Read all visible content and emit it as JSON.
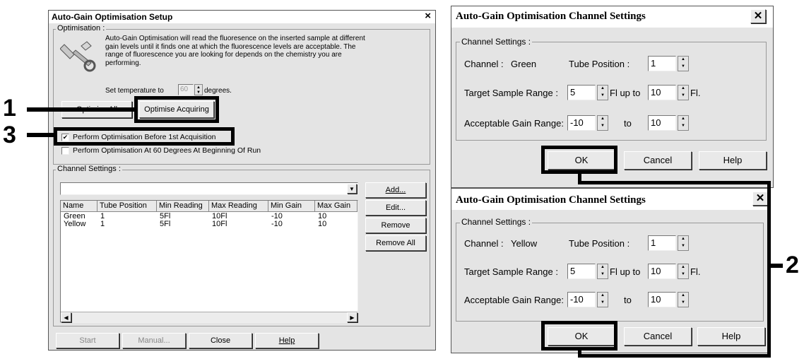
{
  "left_dialog": {
    "title": "Auto-Gain Optimisation Setup",
    "close_glyph": "×",
    "optimisation": {
      "group_label": "Optimisation :",
      "description": "Auto-Gain Optimisation will read the fluoresence on the inserted sample at different gain levels until it finds one at which the fluorescence levels are acceptable. The range of fluorescence you are looking for depends on the chemistry you are performing.",
      "temp_prefix": "Set temperature to",
      "temp_value": "60",
      "temp_suffix": "degrees.",
      "optimise_all": "Optimise All",
      "optimise_acquiring": "Optimise Acquiring",
      "check1_label": "Perform Optimisation Before 1st Acquisition",
      "check1_checked": true,
      "check1_mark": "✔",
      "check2_label": "Perform Optimisation At 60 Degrees At Beginning Of Run",
      "check2_checked": false
    },
    "channel_settings": {
      "group_label": "Channel Settings :",
      "columns": [
        "Name",
        "Tube Position",
        "Min Reading",
        "Max Reading",
        "Min Gain",
        "Max Gain"
      ],
      "rows": [
        [
          "Green",
          "1",
          "5Fl",
          "10Fl",
          "-10",
          "10"
        ],
        [
          "Yellow",
          "1",
          "5Fl",
          "10Fl",
          "-10",
          "10"
        ]
      ],
      "add": "Add...",
      "edit": "Edit...",
      "remove": "Remove",
      "remove_all": "Remove All"
    },
    "footer": {
      "start": "Start",
      "manual": "Manual...",
      "close": "Close",
      "help": "Help"
    }
  },
  "right_dialogs": [
    {
      "title": "Auto-Gain Optimisation Channel Settings",
      "group_label": "Channel Settings :",
      "channel_label": "Channel :",
      "channel_value": "Green",
      "tube_label": "Tube Position :",
      "tube_value": "1",
      "target_label": "Target Sample Range :",
      "target_min": "5",
      "fl_up_to": "Fl up to",
      "target_max": "10",
      "fl_unit": "Fl.",
      "gain_label": "Acceptable Gain Range:",
      "gain_min": "-10",
      "to": "to",
      "gain_max": "10",
      "ok": "OK",
      "cancel": "Cancel",
      "help": "Help"
    },
    {
      "title": "Auto-Gain Optimisation Channel Settings",
      "group_label": "Channel Settings :",
      "channel_label": "Channel :",
      "channel_value": "Yellow",
      "tube_label": "Tube Position :",
      "tube_value": "1",
      "target_label": "Target Sample Range :",
      "target_min": "5",
      "fl_up_to": "Fl up to",
      "target_max": "10",
      "fl_unit": "Fl.",
      "gain_label": "Acceptable Gain Range:",
      "gain_min": "-10",
      "to": "to",
      "gain_max": "10",
      "ok": "OK",
      "cancel": "Cancel",
      "help": "Help"
    }
  ],
  "callouts": {
    "one": "1",
    "two": "2",
    "three": "3"
  }
}
